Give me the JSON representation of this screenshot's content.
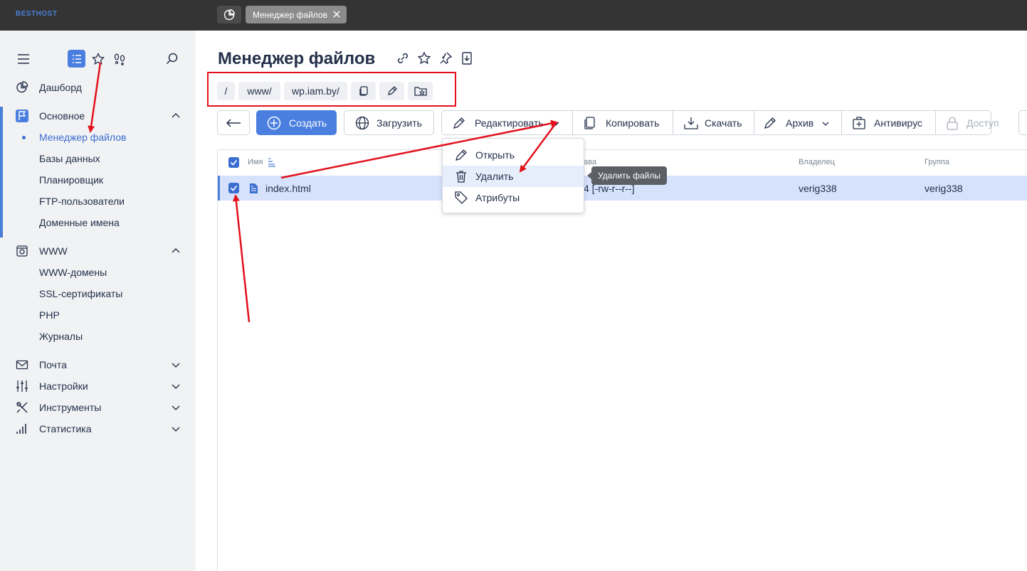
{
  "topbar": {
    "logo": "BESTHOST",
    "tab_label": "Менеджер файлов"
  },
  "sidebar": {
    "dashboard": "Дашборд",
    "main_section": "Основное",
    "main_items": [
      "Менеджер файлов",
      "Базы данных",
      "Планировщик",
      "FTP-пользователи",
      "Доменные имена"
    ],
    "www_section": "WWW",
    "www_items": [
      "WWW-домены",
      "SSL-сертификаты",
      "PHP",
      "Журналы"
    ],
    "mail": "Почта",
    "settings": "Настройки",
    "tools": "Инструменты",
    "stats": "Статистика"
  },
  "page": {
    "title": "Менеджер файлов"
  },
  "breadcrumb": [
    "/",
    "www/",
    "wp.iam.by/"
  ],
  "toolbar": {
    "create": "Создать",
    "upload": "Загрузить",
    "edit": "Редактировать",
    "copy": "Копировать",
    "download": "Скачать",
    "archive": "Архив",
    "antivirus": "Антивирус",
    "access": "Доступ"
  },
  "table": {
    "headers": {
      "name": "Имя",
      "rights": "ава",
      "owner": "Владелец",
      "group": "Группа"
    },
    "rows": [
      {
        "name": "index.html",
        "rights": "4 [-rw-r--r--]",
        "owner": "verig338",
        "group": "verig338"
      }
    ]
  },
  "dropdown": {
    "items": [
      "Открыть",
      "Удалить",
      "Атрибуты"
    ]
  },
  "tooltip": "Удалить файлы",
  "colors": {
    "accent": "#4a7fe0",
    "annotation": "#e3101b",
    "topbar": "#343434",
    "sidebar": "#f1f2f4",
    "selected_row": "#d6e2fb"
  }
}
